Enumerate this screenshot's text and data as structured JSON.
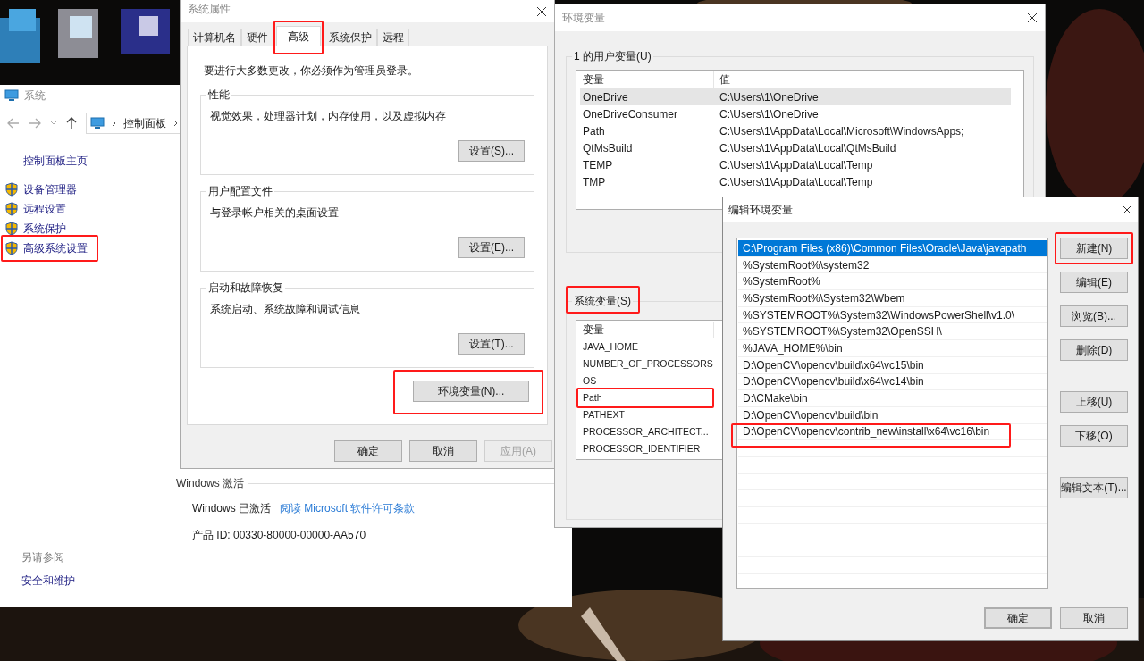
{
  "system_window": {
    "title": "系统",
    "breadcrumb": "控制面板",
    "sidebar": {
      "home": "控制面板主页",
      "items": [
        {
          "label": "设备管理器",
          "highlighted": false
        },
        {
          "label": "远程设置",
          "highlighted": false
        },
        {
          "label": "系统保护",
          "highlighted": false
        },
        {
          "label": "高级系统设置",
          "highlighted": true
        }
      ],
      "see_also_heading": "另请参阅",
      "see_also": [
        "安全和维护"
      ]
    },
    "activation": {
      "heading": "Windows 激活",
      "status": "Windows 已激活",
      "link": "阅读 Microsoft 软件许可条款",
      "product_id": "产品 ID: 00330-80000-00000-AA570"
    }
  },
  "system_properties": {
    "title": "系统属性",
    "tabs": [
      {
        "label": "计算机名",
        "selected": false,
        "highlighted": false
      },
      {
        "label": "硬件",
        "selected": false,
        "highlighted": false
      },
      {
        "label": "高级",
        "selected": true,
        "highlighted": true
      },
      {
        "label": "系统保护",
        "selected": false,
        "highlighted": false
      },
      {
        "label": "远程",
        "selected": false,
        "highlighted": false
      }
    ],
    "notice": "要进行大多数更改，你必须作为管理员登录。",
    "groups": [
      {
        "title": "性能",
        "description": "视觉效果，处理器计划，内存使用，以及虚拟内存",
        "button": "设置(S)..."
      },
      {
        "title": "用户配置文件",
        "description": "与登录帐户相关的桌面设置",
        "button": "设置(E)..."
      },
      {
        "title": "启动和故障恢复",
        "description": "系统启动、系统故障和调试信息",
        "button": "设置(T)..."
      }
    ],
    "env_button": {
      "label": "环境变量(N)...",
      "highlighted": true
    },
    "buttons": [
      {
        "label": "确定",
        "disabled": false
      },
      {
        "label": "取消",
        "disabled": false
      },
      {
        "label": "应用(A)",
        "disabled": true
      }
    ]
  },
  "environment_variables": {
    "title": "环境变量",
    "user_group": "1 的用户变量(U)",
    "user_table": {
      "columns": [
        "变量",
        "值"
      ],
      "rows": [
        {
          "name": "OneDrive",
          "value": "C:\\Users\\1\\OneDrive",
          "selected": true
        },
        {
          "name": "OneDriveConsumer",
          "value": "C:\\Users\\1\\OneDrive",
          "selected": false
        },
        {
          "name": "Path",
          "value": "C:\\Users\\1\\AppData\\Local\\Microsoft\\WindowsApps;",
          "selected": false
        },
        {
          "name": "QtMsBuild",
          "value": "C:\\Users\\1\\AppData\\Local\\QtMsBuild",
          "selected": false
        },
        {
          "name": "TEMP",
          "value": "C:\\Users\\1\\AppData\\Local\\Temp",
          "selected": false
        },
        {
          "name": "TMP",
          "value": "C:\\Users\\1\\AppData\\Local\\Temp",
          "selected": false
        }
      ]
    },
    "system_group": {
      "label": "系统变量(S)",
      "highlighted": true
    },
    "system_table": {
      "columns": [
        "变量"
      ],
      "rows": [
        {
          "name": "JAVA_HOME",
          "highlighted": false
        },
        {
          "name": "NUMBER_OF_PROCESSORS",
          "highlighted": false
        },
        {
          "name": "OS",
          "highlighted": false
        },
        {
          "name": "Path",
          "highlighted": true
        },
        {
          "name": "PATHEXT",
          "highlighted": false
        },
        {
          "name": "PROCESSOR_ARCHITECT...",
          "highlighted": false
        },
        {
          "name": "PROCESSOR_IDENTIFIER",
          "highlighted": false
        }
      ]
    }
  },
  "edit_dialog": {
    "title": "编辑环境变量",
    "entries": [
      {
        "path": "C:\\Program Files (x86)\\Common Files\\Oracle\\Java\\javapath",
        "selected": true,
        "highlighted": false
      },
      {
        "path": "%SystemRoot%\\system32",
        "selected": false,
        "highlighted": false
      },
      {
        "path": "%SystemRoot%",
        "selected": false,
        "highlighted": false
      },
      {
        "path": "%SystemRoot%\\System32\\Wbem",
        "selected": false,
        "highlighted": false
      },
      {
        "path": "%SYSTEMROOT%\\System32\\WindowsPowerShell\\v1.0\\",
        "selected": false,
        "highlighted": false
      },
      {
        "path": "%SYSTEMROOT%\\System32\\OpenSSH\\",
        "selected": false,
        "highlighted": false
      },
      {
        "path": "%JAVA_HOME%\\bin",
        "selected": false,
        "highlighted": false
      },
      {
        "path": "D:\\OpenCV\\opencv\\build\\x64\\vc15\\bin",
        "selected": false,
        "highlighted": false
      },
      {
        "path": "D:\\OpenCV\\opencv\\build\\x64\\vc14\\bin",
        "selected": false,
        "highlighted": false
      },
      {
        "path": "D:\\CMake\\bin",
        "selected": false,
        "highlighted": false
      },
      {
        "path": "D:\\OpenCV\\opencv\\build\\bin",
        "selected": false,
        "highlighted": false
      },
      {
        "path": "D:\\OpenCV\\opencv\\contrib_new\\install\\x64\\vc16\\bin",
        "selected": false,
        "highlighted": true
      }
    ],
    "side_button_groups": [
      [
        {
          "label": "新建(N)",
          "highlighted": true
        },
        {
          "label": "编辑(E)",
          "highlighted": false
        },
        {
          "label": "浏览(B)...",
          "highlighted": false
        },
        {
          "label": "删除(D)",
          "highlighted": false
        }
      ],
      [
        {
          "label": "上移(U)",
          "highlighted": false
        },
        {
          "label": "下移(O)",
          "highlighted": false
        }
      ],
      [
        {
          "label": "编辑文本(T)...",
          "highlighted": false
        }
      ]
    ],
    "buttons": [
      {
        "label": "确定",
        "default": true
      },
      {
        "label": "取消",
        "default": false
      }
    ]
  }
}
